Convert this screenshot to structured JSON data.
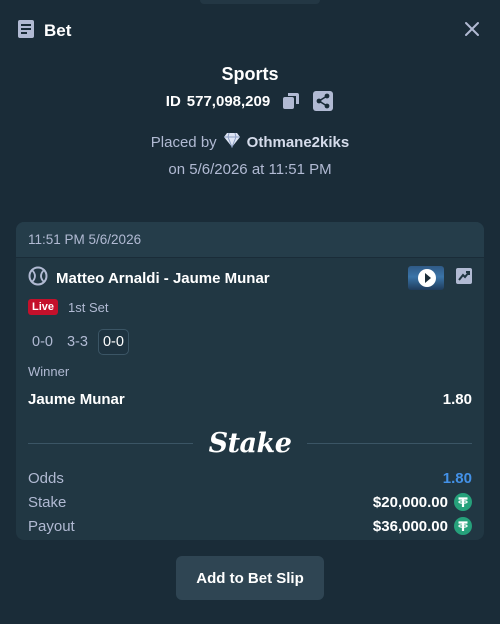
{
  "header": {
    "title": "Bet",
    "icon": "receipt-icon",
    "close_icon": "close-icon"
  },
  "bet": {
    "sport": "Sports",
    "id_prefix": "ID",
    "id_value": "577,098,209",
    "placed_by_label": "Placed by",
    "user": "Othmane2kiks",
    "user_badge": "diamond-vip-icon",
    "placed_on": "on 5/6/2026 at 11:51 PM"
  },
  "card": {
    "timestamp": "11:51 PM 5/6/2026",
    "sport_icon": "tennis-ball-icon",
    "event_name": "Matteo Arnaldi - Jaume Munar",
    "live_label": "Live",
    "period": "1st Set",
    "scores": [
      "0-0",
      "3-3",
      "0-0"
    ],
    "market": "Winner",
    "outcome": "Jaume Munar",
    "outcome_odds": "1.80",
    "brand": "Stake"
  },
  "summary": {
    "odds_label": "Odds",
    "odds_value": "1.80",
    "stake_label": "Stake",
    "stake_value": "$20,000.00",
    "payout_label": "Payout",
    "payout_value": "$36,000.00",
    "currency_icon": "tether-icon"
  },
  "actions": {
    "add_label": "Add to Bet Slip"
  },
  "colors": {
    "background": "#1a2c38",
    "card": "#213743",
    "odds_blue": "#4391e7",
    "live_red": "#c4102b",
    "tether_green": "#26a17b"
  }
}
